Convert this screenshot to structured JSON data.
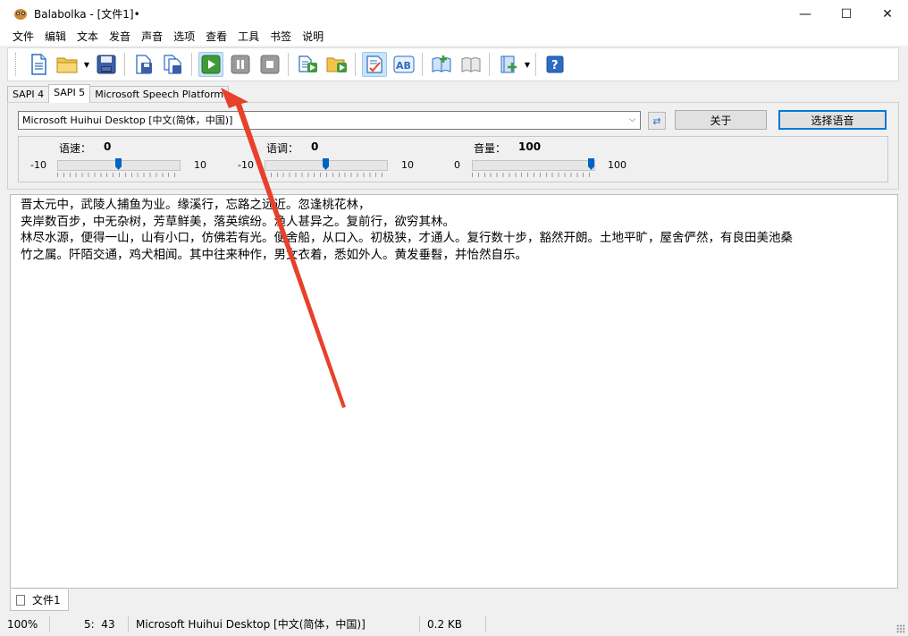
{
  "window": {
    "title": "Balabolka - [文件1]•",
    "controls": {
      "minimize": "—",
      "maximize": "☐",
      "close": "✕"
    }
  },
  "menu": [
    "文件",
    "编辑",
    "文本",
    "发音",
    "声音",
    "选项",
    "查看",
    "工具",
    "书签",
    "说明"
  ],
  "toolbar": {
    "buttons": [
      "new-document",
      "open-folder",
      "save",
      "save-audio",
      "split-audio",
      "play",
      "pause",
      "stop",
      "read-clipboard",
      "read-file",
      "spell-check",
      "pronunciation",
      "add-bookmark",
      "bookmarks",
      "add-dictionary",
      "help"
    ]
  },
  "engine_tabs": [
    "SAPI 4",
    "SAPI 5",
    "Microsoft Speech Platform"
  ],
  "active_engine_tab": "SAPI 5",
  "voice": {
    "selected": "Microsoft Huihui Desktop [中文(简体，中国)]",
    "about_label": "关于",
    "choose_label": "选择语音"
  },
  "sliders": {
    "rate": {
      "label": "语速：",
      "value": "0",
      "min": "-10",
      "max": "10",
      "position": 0.5
    },
    "pitch": {
      "label": "语调：",
      "value": "0",
      "min": "-10",
      "max": "10",
      "position": 0.5
    },
    "volume": {
      "label": "音量：",
      "value": "100",
      "min": "0",
      "max": "100",
      "position": 1.0
    }
  },
  "document": {
    "lines": [
      "晋太元中，武陵人捕鱼为业。缘溪行，忘路之远近。忽逢桃花林，",
      "夹岸数百步，中无杂树，芳草鲜美，落英缤纷。渔人甚异之。复前行，欲穷其林。",
      "",
      "林尽水源，便得一山，山有小口，仿佛若有光。便舍船，从口入。初极狭，才通人。复行数十步，豁然开朗。土地平旷，屋舍俨然，有良田美池桑",
      "竹之属。阡陌交通，鸡犬相闻。其中往来种作，男女衣着，悉如外人。黄发垂髫，并怡然自乐。"
    ]
  },
  "doc_tabs": [
    "文件1"
  ],
  "status": {
    "zoom": "100%",
    "position": "5:  43",
    "voice": "Microsoft Huihui Desktop [中文(简体，中国)]",
    "size": "0.2 KB"
  },
  "colors": {
    "annotation_arrow": "#e8412b",
    "accent": "#0078d7"
  }
}
